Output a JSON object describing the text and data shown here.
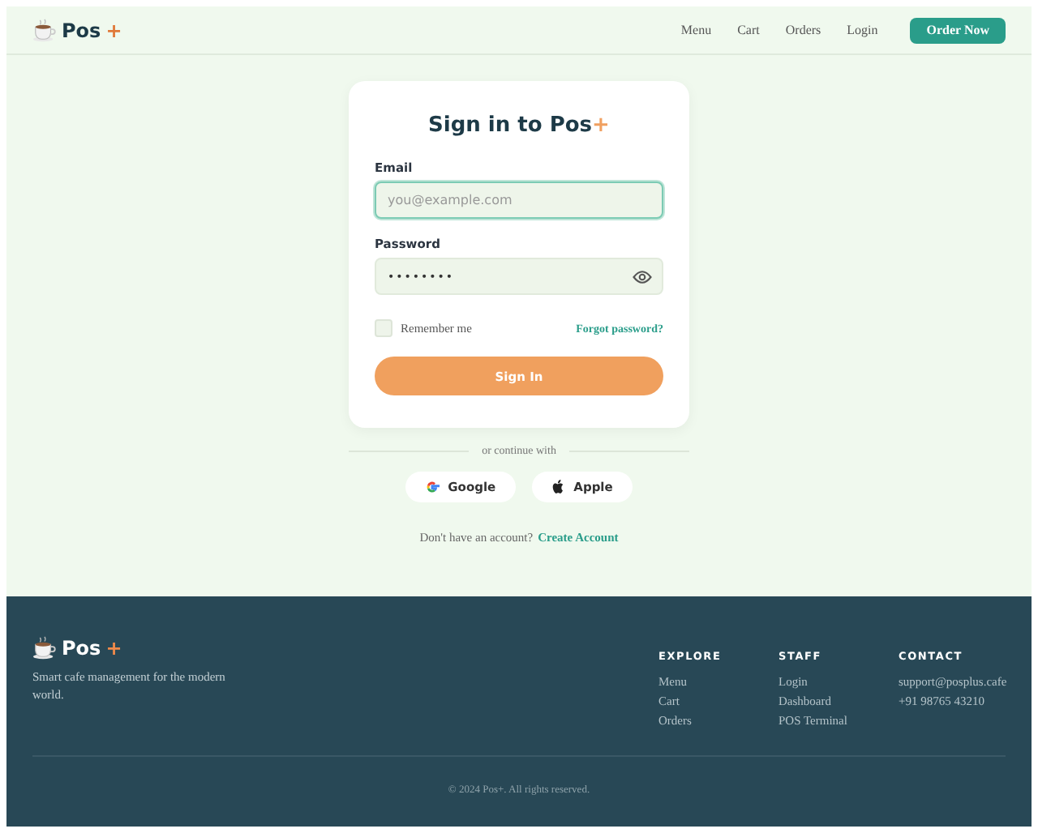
{
  "header": {
    "brand": {
      "name": "Pos",
      "accent": "+"
    },
    "nav": [
      {
        "label": "Menu"
      },
      {
        "label": "Cart"
      },
      {
        "label": "Orders"
      },
      {
        "label": "Login"
      }
    ],
    "cta": "Order Now"
  },
  "signin": {
    "title": "Sign in to Pos",
    "title_accent": "+",
    "fields": [
      {
        "label": "Email",
        "placeholder": "you@example.com",
        "focused": true,
        "kind": "email"
      },
      {
        "label": "Password",
        "value": "••••••••",
        "focused": false,
        "kind": "password"
      }
    ],
    "remember": {
      "label": "Remember me",
      "checked": false
    },
    "forgot": "Forgot password?",
    "submit": "Sign In"
  },
  "divider_text": "or continue with",
  "social": [
    {
      "label": "Google",
      "kind": "google"
    },
    {
      "label": "Apple",
      "kind": "apple"
    }
  ],
  "signup": {
    "text": "Don't have an account?",
    "link": "Create Account"
  },
  "footer": {
    "brand": {
      "name": "Pos",
      "accent": "+"
    },
    "tagline": "Smart cafe management for the modern world.",
    "columns": [
      {
        "heading": "EXPLORE",
        "links": [
          "Menu",
          "Cart",
          "Orders"
        ]
      },
      {
        "heading": "STAFF",
        "links": [
          "Login",
          "Dashboard",
          "POS Terminal"
        ]
      },
      {
        "heading": "CONTACT",
        "links": [
          "support@posplus.cafe",
          "+91 98765 43210"
        ]
      }
    ],
    "copyright": "© 2024 Pos+. All rights reserved."
  }
}
